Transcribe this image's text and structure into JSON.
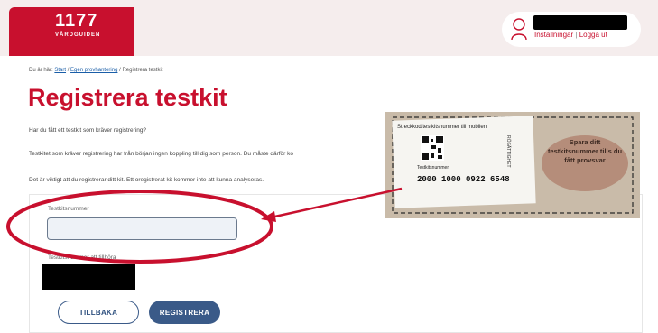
{
  "header": {
    "logo_number": "1177",
    "logo_subtitle": "VÅRDGUIDEN",
    "settings_link": "Inställningar",
    "logout_link": "Logga ut",
    "separator": "|"
  },
  "breadcrumb": {
    "prefix": "Du är här:",
    "items": [
      "Start",
      "Egen provhantering",
      "Registrera testkit"
    ],
    "sep": "/"
  },
  "page": {
    "title": "Registrera testkit",
    "intro": "Har du fått ett testkit som kräver registrering?",
    "para1": "Testkitet som kräver registrering har från början ingen koppling till dig som person. Du måste därför ko",
    "para2": "Det är viktigt att du registrerar ditt kit. Ett oregistrerat kit kommer inte att kunna analyseras."
  },
  "form": {
    "field_label": "Testkitsnummer",
    "field_value": "",
    "field_placeholder": "",
    "second_label": "Testkitsnummer att tillhöra",
    "back_button": "TILLBAKA",
    "register_button": "REGISTRERA"
  },
  "photo": {
    "sticker_title": "Streckkod/testkitsnummer till mobilen",
    "barcode_label": "Testkitsnummer",
    "barcode_number": "2000 1000 0922 6548",
    "bubble_text": "Spara ditt testkitsnummer tills du fått provsvar",
    "side_text": "RÖSÄTTIGHET"
  },
  "colors": {
    "brand": "#c8102e",
    "button": "#3a5a88",
    "annotation": "#c8102e"
  }
}
